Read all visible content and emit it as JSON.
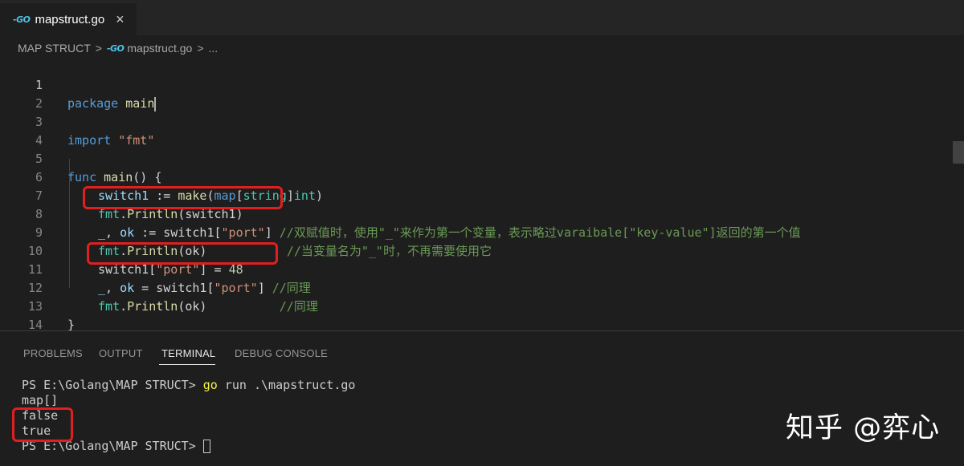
{
  "tab": {
    "logo": "-GO",
    "title": "mapstruct.go",
    "close": "×"
  },
  "breadcrumb": {
    "folder": "MAP STRUCT",
    "sep1": ">",
    "logo": "-GO",
    "file": "mapstruct.go",
    "sep2": ">",
    "more": "..."
  },
  "editor": {
    "line_numbers": [
      "1",
      "2",
      "3",
      "4",
      "5",
      "6",
      "7",
      "8",
      "9",
      "10",
      "11",
      "12",
      "13",
      "14"
    ],
    "l1": {
      "kw": "package",
      "name": "main"
    },
    "l3": {
      "kw": "import",
      "str": "\"fmt\""
    },
    "l5": {
      "kw": "func",
      "fn": "main",
      "rest": "() {"
    },
    "l6": {
      "var": "switch1",
      "op": " := ",
      "fn": "make",
      "p1": "(",
      "map": "map",
      "b1": "[",
      "t1": "string",
      "b2": "]",
      "t2": "int",
      "p2": ")"
    },
    "l7": {
      "pkg": "fmt",
      "dot": ".",
      "fn": "Println",
      "rest": "(switch1)"
    },
    "l8": {
      "blank": "_",
      "c": ", ",
      "ok": "ok",
      "op": " := ",
      "var": "switch1",
      "b1": "[",
      "str": "\"port\"",
      "b2": "]",
      "comment": "//双赋值时，使用\"_\"来作为第一个变量，表示略过varaibale[\"key-value\"]返回的第一个值"
    },
    "l9": {
      "pkg": "fmt",
      "dot": ".",
      "fn": "Println",
      "rest": "(ok)",
      "pad": "           ",
      "comment": "//当变量名为\"_\"时，不再需要使用它"
    },
    "l10": {
      "var": "switch1",
      "b1": "[",
      "str": "\"port\"",
      "rest": "] = ",
      "num": "48"
    },
    "l11": {
      "blank": "_",
      "c": ", ",
      "ok": "ok",
      "op": " = ",
      "var": "switch1",
      "b1": "[",
      "str": "\"port\"",
      "b2": "]",
      "comment": "//同理"
    },
    "l12": {
      "pkg": "fmt",
      "dot": ".",
      "fn": "Println",
      "rest": "(ok)",
      "pad": "          ",
      "comment": "//同理"
    },
    "l13": {
      "rest": "}"
    }
  },
  "panel": {
    "tabs": [
      "PROBLEMS",
      "OUTPUT",
      "TERMINAL",
      "DEBUG CONSOLE"
    ],
    "active": "TERMINAL"
  },
  "terminal": {
    "prompt1": "PS E:\\Golang\\MAP STRUCT> ",
    "cmd": "go",
    "args": " run .\\mapstruct.go",
    "out1": "map[]",
    "out2": "false",
    "out3": "true",
    "prompt2": "PS E:\\Golang\\MAP STRUCT> "
  },
  "watermark": "知乎 @弈心"
}
